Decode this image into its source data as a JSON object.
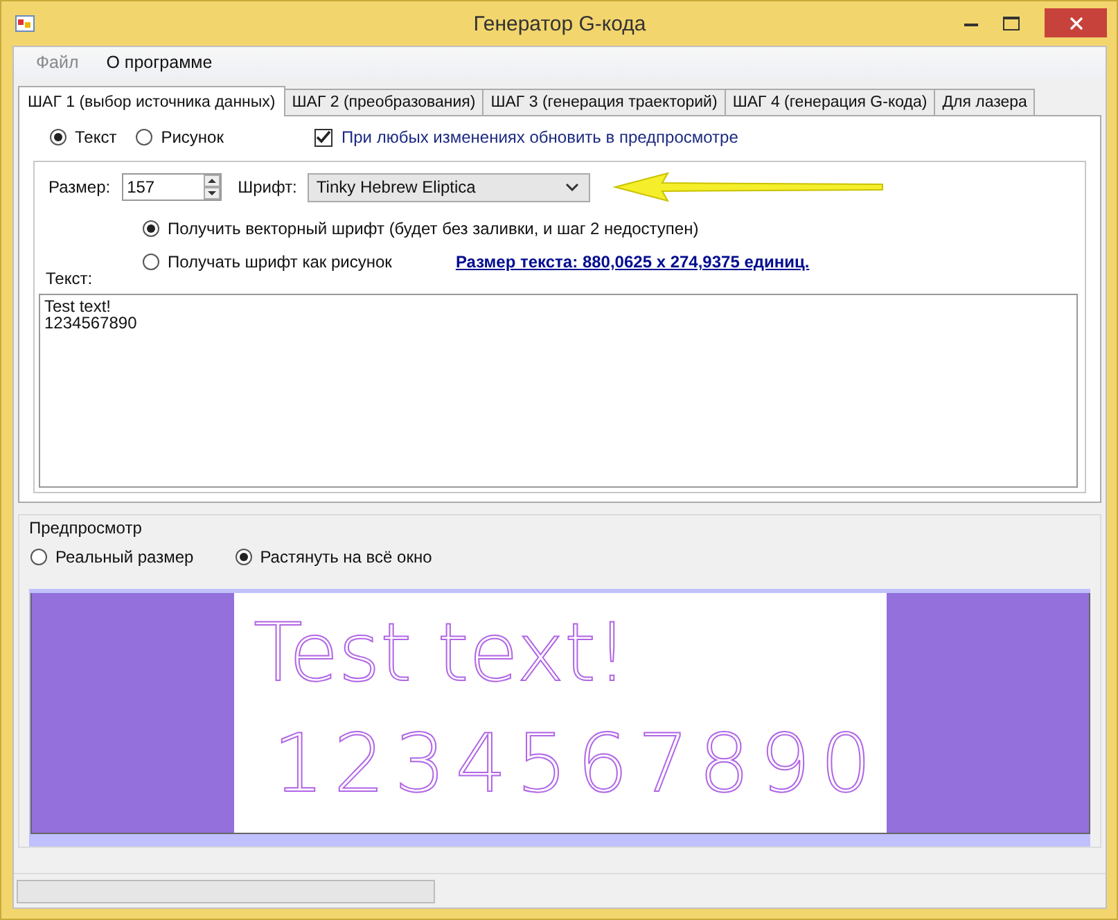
{
  "window": {
    "title": "Генератор G-кода"
  },
  "menu": [
    {
      "label": "Файл",
      "disabled": true
    },
    {
      "label": "О программе",
      "disabled": false
    }
  ],
  "tabs": [
    {
      "label": "ШАГ 1 (выбор источника данных)",
      "selected": true
    },
    {
      "label": "ШАГ 2 (преобразования)",
      "selected": false
    },
    {
      "label": "ШАГ 3 (генерация траекторий)",
      "selected": false
    },
    {
      "label": "ШАГ 4 (генерация G-кода)",
      "selected": false
    },
    {
      "label": "Для лазера",
      "selected": false
    }
  ],
  "source": [
    {
      "label": "Текст",
      "selected": true
    },
    {
      "label": "Рисунок",
      "selected": false
    }
  ],
  "auto_update": {
    "label": "При любых изменениях обновить в предпросмотре",
    "checked": true
  },
  "size": {
    "label": "Размер:",
    "value": "157"
  },
  "font": {
    "label": "Шрифт:",
    "value": "Tinky Hebrew Eliptica"
  },
  "font_mode": [
    {
      "label": "Получить векторный шрифт (будет без заливки, и шаг 2 недоступен)",
      "selected": true
    },
    {
      "label": "Получать шрифт как рисунок",
      "selected": false
    }
  ],
  "text_size_link": "Размер текста: 880,0625 x 274,9375 единиц.",
  "text": {
    "label": "Текст:",
    "lines": [
      "Test text!",
      "1234567890"
    ]
  },
  "preview": {
    "title": "Предпросмотр",
    "modes": [
      {
        "label": "Реальный размер",
        "selected": false
      },
      {
        "label": "Растянуть на всё окно",
        "selected": true
      }
    ],
    "lines": [
      "Test text!",
      "1234567890"
    ]
  },
  "status_bar": {
    "progress": {
      "level": 0
    }
  }
}
